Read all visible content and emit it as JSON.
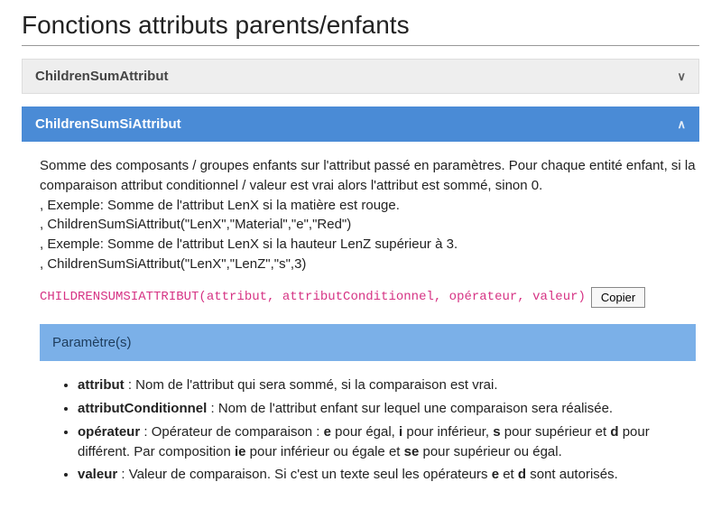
{
  "title": "Fonctions attributs parents/enfants",
  "sections": [
    {
      "name": "ChildrenSumAttribut",
      "expanded": false
    },
    {
      "name": "ChildrenSumSiAttribut",
      "expanded": true
    }
  ],
  "description": {
    "line1": "Somme des composants / groupes enfants sur l'attribut passé en paramètres. Pour chaque entité enfant, si la comparaison attribut conditionnel / valeur est vrai alors l'attribut est sommé, sinon 0.",
    "line2": ", Exemple: Somme de l'attribut LenX si la matière est rouge.",
    "line3": ", ChildrenSumSiAttribut(\"LenX\",\"Material\",\"e\",\"Red\")",
    "line4": ", Exemple: Somme de l'attribut LenX si la hauteur LenZ supérieur à 3.",
    "line5": ", ChildrenSumSiAttribut(\"LenX\",\"LenZ\",\"s\",3)"
  },
  "signature": "CHILDRENSUMSIATTRIBUT(attribut, attributConditionnel, opérateur, valeur)",
  "copy_label": "Copier",
  "params_heading": "Paramètre(s)",
  "params": [
    {
      "name": "attribut",
      "text": " : Nom de l'attribut qui sera sommé, si la comparaison est vrai."
    },
    {
      "name": "attributConditionnel",
      "text": " : Nom de l'attribut enfant sur lequel une comparaison sera réalisée."
    },
    {
      "name": "opérateur",
      "pre": " : Opérateur de comparaison : ",
      "seq": [
        {
          "b": "e"
        },
        {
          "t": " pour égal, "
        },
        {
          "b": "i"
        },
        {
          "t": " pour inférieur, "
        },
        {
          "b": "s"
        },
        {
          "t": " pour supérieur et "
        },
        {
          "b": "d"
        },
        {
          "t": " pour différent. Par composition "
        },
        {
          "b": "ie"
        },
        {
          "t": " pour inférieur ou égale et "
        },
        {
          "b": "se"
        },
        {
          "t": " pour supérieur ou égal."
        }
      ]
    },
    {
      "name": "valeur",
      "pre": " : Valeur de comparaison. Si c'est un texte seul les opérateurs ",
      "seq": [
        {
          "b": "e"
        },
        {
          "t": " et "
        },
        {
          "b": "d"
        },
        {
          "t": " sont autorisés."
        }
      ]
    }
  ]
}
